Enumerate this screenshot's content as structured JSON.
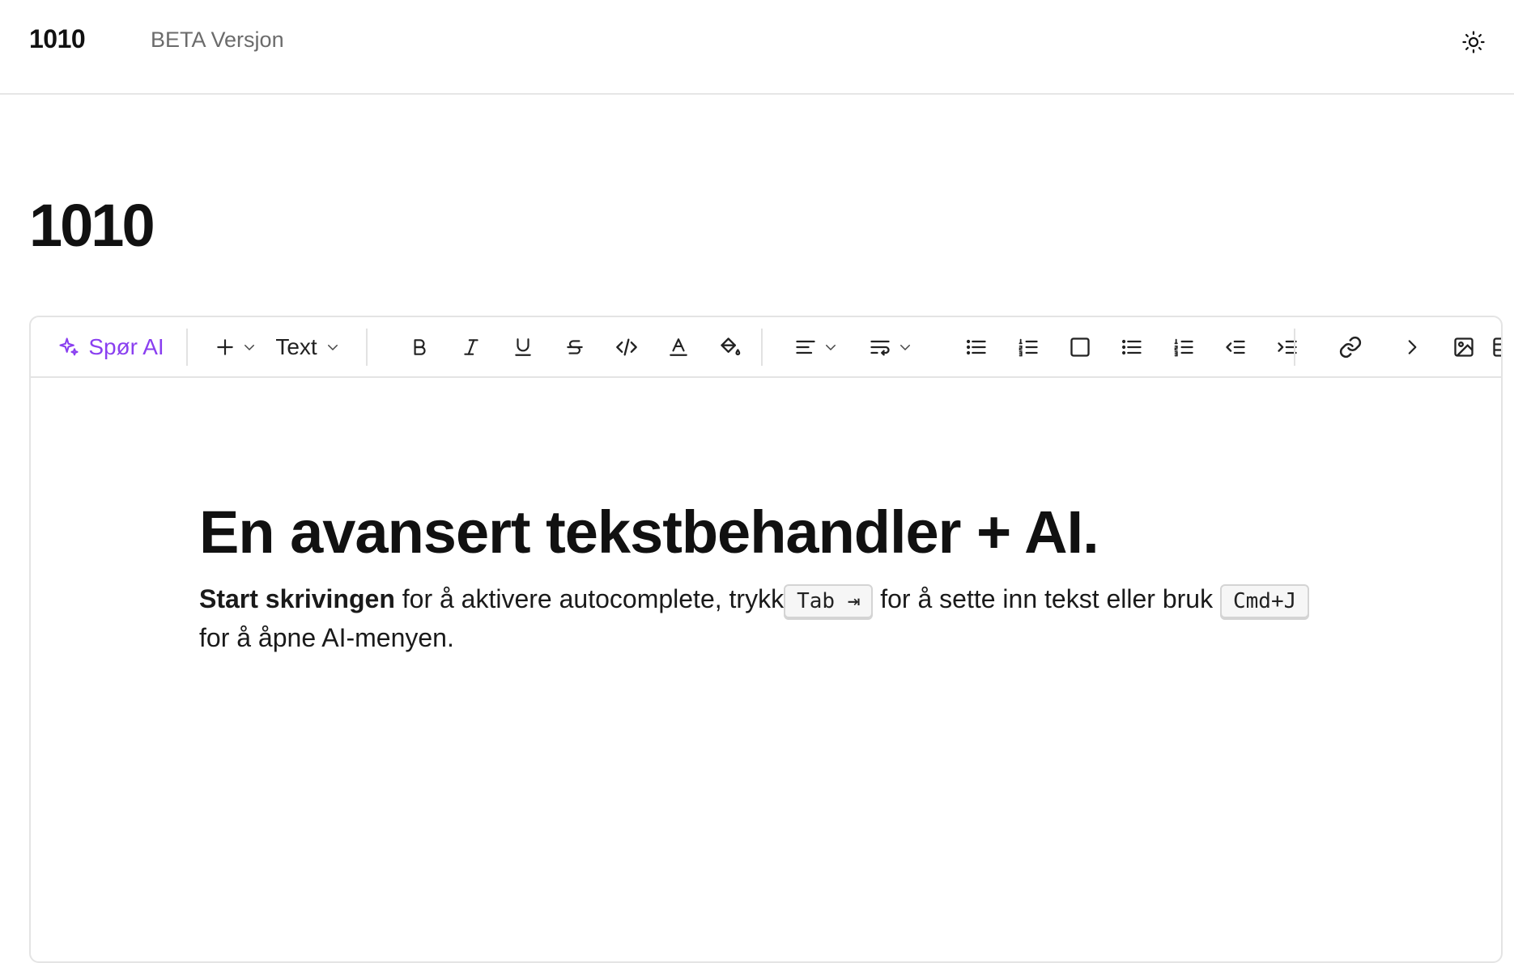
{
  "header": {
    "brand": "1010",
    "beta_label": "BETA Versjon",
    "theme_icon": "sun-icon"
  },
  "page": {
    "title": "1010"
  },
  "toolbar": {
    "ai_label": "Spør AI",
    "ai_icon": "sparkles-icon",
    "text_style_label": "Text",
    "accent_color": "#8a3ff0",
    "icons": [
      "plus-icon",
      "bold-icon",
      "italic-icon",
      "underline-icon",
      "strikethrough-icon",
      "code-icon",
      "text-color-icon",
      "highlight-icon",
      "align-icon",
      "line-wrap-icon",
      "bullet-list-icon",
      "ordered-list-icon",
      "checkbox-icon",
      "bullet-list-icon",
      "ordered-list-icon",
      "outdent-icon",
      "indent-icon",
      "link-icon",
      "chevron-right-icon",
      "image-icon",
      "table-icon"
    ]
  },
  "editor": {
    "heading": "En avansert tekstbehandler + AI.",
    "para": {
      "bold_start": "Start skrivingen",
      "text1": " for å aktivere autocomplete, trykk",
      "kbd_tab": "Tab ⇥",
      "text2": " for å sette inn tekst eller bruk ",
      "kbd_cmd": "Cmd+J",
      "text3": " for å åpne AI-menyen."
    }
  }
}
